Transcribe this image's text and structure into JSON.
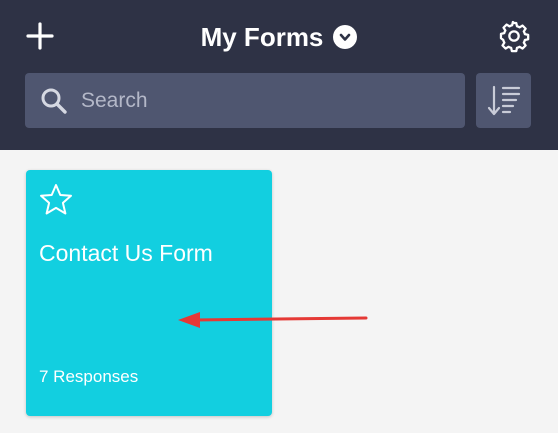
{
  "header": {
    "title": "My Forms",
    "icons": {
      "add": "plus-icon",
      "title_dropdown": "chevron-down-icon",
      "settings": "gear-icon"
    },
    "background": "#2e3245"
  },
  "search": {
    "placeholder": "Search",
    "value": "",
    "icon": "search-icon",
    "background": "#4f5670"
  },
  "sort": {
    "icon": "sort-icon"
  },
  "forms": [
    {
      "title": "Contact Us Form",
      "responses": "7 Responses",
      "favorite_icon": "star-outline-icon",
      "favorited": false,
      "color": "#12cfe0"
    }
  ],
  "annotation": {
    "type": "arrow",
    "color": "#e53935",
    "direction": "left"
  }
}
